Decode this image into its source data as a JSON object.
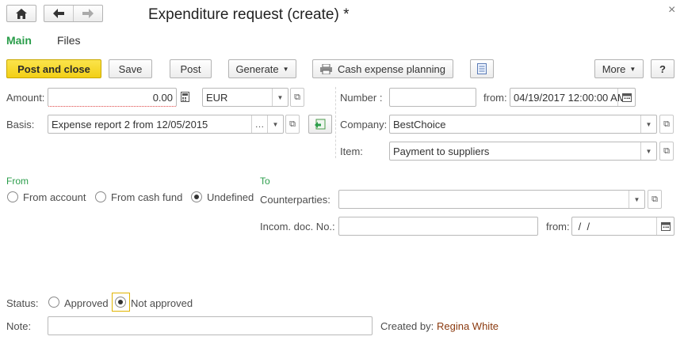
{
  "window": {
    "title": "Expenditure request (create) *",
    "close_glyph": "×"
  },
  "tabs": [
    {
      "label": "Main",
      "active": true
    },
    {
      "label": "Files",
      "active": false
    }
  ],
  "toolbar": {
    "post_close_label": "Post and close",
    "save_label": "Save",
    "post_label": "Post",
    "generate_label": "Generate",
    "cash_planning_label": "Cash expense planning",
    "more_label": "More",
    "help_label": "?"
  },
  "form": {
    "amount_label": "Amount:",
    "amount_value": "0.00",
    "currency_value": "EUR",
    "basis_label": "Basis:",
    "basis_value": "Expense report 2 from 12/05/2015",
    "number_label": "Number :",
    "number_value": "",
    "from_label": "from:",
    "date_value": "04/19/2017 12:00:00 AM",
    "company_label": "Company:",
    "company_value": "BestChoice",
    "item_label": "Item:",
    "item_value": "Payment to suppliers"
  },
  "from_section": {
    "heading": "From",
    "options": [
      "From account",
      "From cash fund",
      "Undefined"
    ],
    "selected": "Undefined"
  },
  "to_section": {
    "heading": "To",
    "counterparties_label": "Counterparties:",
    "counterparties_value": "",
    "incoming_doc_label": "Incom. doc. No.:",
    "incoming_doc_value": "",
    "from_label": "from:",
    "incoming_date_value": " /  /"
  },
  "status": {
    "label": "Status:",
    "options": [
      "Approved",
      "Not approved"
    ],
    "selected": "Not approved"
  },
  "note": {
    "label": "Note:",
    "value": "",
    "created_by_label": "Created by:",
    "created_by_value": "Regina White"
  },
  "colors": {
    "accent_green": "#2a9d4a",
    "primary_button": "#f2cf16",
    "author_link": "#8b3a0f"
  },
  "icons": [
    "home-icon",
    "back-arrow-icon",
    "forward-arrow-icon",
    "close-icon",
    "report-icon",
    "printer-icon",
    "calculator-icon",
    "calendar-icon",
    "dropdown-arrow-icon",
    "open-icon",
    "fill-basis-icon"
  ]
}
